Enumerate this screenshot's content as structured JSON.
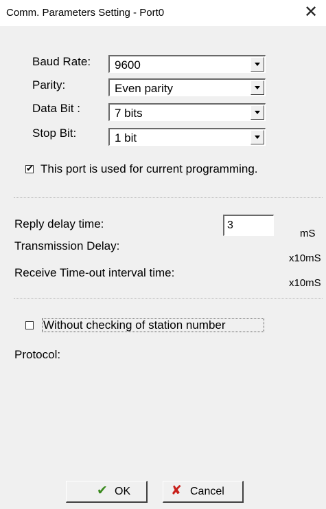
{
  "window": {
    "title": "Comm. Parameters Setting - Port0",
    "close_glyph": "✕"
  },
  "settings": {
    "baud_rate": {
      "label": "Baud Rate:",
      "value": "9600"
    },
    "parity": {
      "label": "Parity:",
      "value": "Even parity"
    },
    "data_bit": {
      "label": "Data Bit :",
      "value": "7 bits"
    },
    "stop_bit": {
      "label": "Stop Bit:",
      "value": "1 bit"
    }
  },
  "programming_port": {
    "label": "This port is used for current programming.",
    "checked": true,
    "mark": "✔"
  },
  "timing": {
    "reply_delay": {
      "label": "Reply delay time:",
      "value": "3",
      "unit": "mS"
    },
    "transmission_delay": {
      "label": "Transmission Delay:",
      "unit": "x10mS"
    },
    "receive_timeout": {
      "label": "Receive Time-out interval time:",
      "unit": "x10mS"
    }
  },
  "station_check": {
    "label": "Without checking of station number",
    "checked": false
  },
  "protocol": {
    "label": "Protocol:"
  },
  "buttons": {
    "ok": {
      "label": "OK",
      "icon": "checkmark-icon",
      "glyph": "✔",
      "color": "#3a8a1e"
    },
    "cancel": {
      "label": "Cancel",
      "icon": "cross-icon",
      "glyph": "✘",
      "color": "#c8201b"
    }
  }
}
